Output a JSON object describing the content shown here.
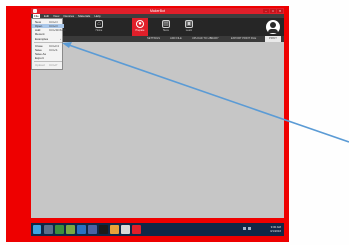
{
  "window": {
    "title": "MakerBot"
  },
  "menubar": {
    "items": [
      "File",
      "Edit",
      "View",
      "Devices",
      "Materials",
      "Help"
    ]
  },
  "toolbar": {
    "tools": [
      {
        "label": "Home",
        "icon": "home-icon",
        "active": false
      },
      {
        "label": "Prepare",
        "icon": "prepare-icon",
        "active": true
      },
      {
        "label": "Store",
        "icon": "store-icon",
        "active": false
      },
      {
        "label": "Learn",
        "icon": "learn-icon",
        "active": false
      }
    ]
  },
  "tabs": [
    "SETTINGS",
    "ADD FILE",
    "UPLOAD TO LIBRARY",
    "EXPORT PRINT FILE",
    "PRINT"
  ],
  "file_menu": {
    "items": [
      {
        "label": "New",
        "shortcut": "Ctrl+N",
        "selected": false,
        "disabled": false
      },
      {
        "label": "Open",
        "shortcut": "Ctrl+O",
        "selected": true,
        "disabled": false
      },
      {
        "label": "Add",
        "shortcut": "Ctrl+Shift+O",
        "selected": false,
        "disabled": false
      },
      {
        "label": "Recent",
        "shortcut": "",
        "selected": false,
        "disabled": false
      },
      {
        "label": "Examples",
        "shortcut": "",
        "selected": false,
        "disabled": false
      },
      {
        "label": "Close",
        "shortcut": "Ctrl+F4",
        "selected": false,
        "disabled": false
      },
      {
        "label": "Save",
        "shortcut": "Ctrl+S",
        "selected": false,
        "disabled": false
      },
      {
        "label": "Save As",
        "shortcut": "",
        "selected": false,
        "disabled": false
      },
      {
        "label": "Export",
        "shortcut": "",
        "selected": false,
        "disabled": false
      },
      {
        "label": "Upload",
        "shortcut": "Ctrl+P",
        "selected": false,
        "disabled": true
      }
    ]
  },
  "taskbar": {
    "time": "9:00 AM",
    "date": "3/1/2016"
  },
  "colors": {
    "frame": "#ee0000",
    "accent": "#e01f2a",
    "arrow": "#5b9bd5",
    "taskbar": "#102746"
  }
}
